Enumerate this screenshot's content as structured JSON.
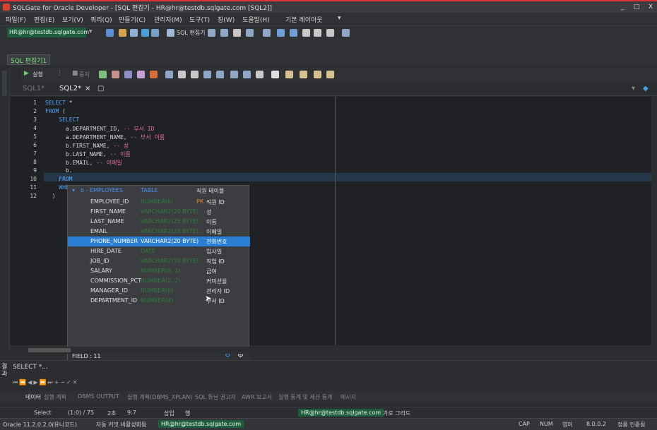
{
  "window": {
    "title": "SQLGate for Oracle Developer - [SQL 편집기 - HR@hr@testdb.sqlgate.com [SQL2]]",
    "controls": [
      "_",
      "□",
      "X"
    ]
  },
  "menu": [
    "파일(F)",
    "편집(E)",
    "보기(V)",
    "쿼리(Q)",
    "만들기(C)",
    "관리자(M)",
    "도구(T)",
    "창(W)",
    "도움말(H)",
    "기본 레이아웃"
  ],
  "toolbar": {
    "connection": "HR@hr@testdb.sqlgate.com",
    "sql_editor_label": "SQL 편집기"
  },
  "doc_tab": "SQL 편집기1",
  "run_toolbar": {
    "run": "실행",
    "stop": "중지"
  },
  "sql_tabs": [
    {
      "label": "SQL1*",
      "active": false
    },
    {
      "label": "SQL2*",
      "active": true
    }
  ],
  "editor": {
    "lines": [
      {
        "n": "1",
        "parts": [
          [
            "kw",
            "SELECT"
          ],
          [
            "",
            " *"
          ]
        ]
      },
      {
        "n": "2",
        "parts": [
          [
            "kw",
            "FROM"
          ],
          [
            "",
            " ("
          ]
        ]
      },
      {
        "n": "3",
        "parts": [
          [
            "kw",
            "    SELECT"
          ]
        ]
      },
      {
        "n": "4",
        "parts": [
          [
            "",
            "      a.DEPARTMENT_ID, "
          ],
          [
            "cmt",
            "-- 부서 ID"
          ]
        ]
      },
      {
        "n": "5",
        "parts": [
          [
            "",
            "      a.DEPARTMENT_NAME, "
          ],
          [
            "cmt",
            "-- 부서 이름"
          ]
        ]
      },
      {
        "n": "6",
        "parts": [
          [
            "",
            "      b.FIRST_NAME, "
          ],
          [
            "cmt",
            "-- 성"
          ]
        ]
      },
      {
        "n": "7",
        "parts": [
          [
            "",
            "      b.LAST_NAME, "
          ],
          [
            "cmt",
            "-- 이름"
          ]
        ]
      },
      {
        "n": "8",
        "parts": [
          [
            "",
            "      b.EMAIL, "
          ],
          [
            "cmt",
            "-- 이메일"
          ]
        ]
      },
      {
        "n": "9",
        "parts": [
          [
            "",
            "      b."
          ]
        ]
      },
      {
        "n": "10",
        "parts": [
          [
            "kw",
            "    FROM"
          ]
        ]
      },
      {
        "n": "11",
        "parts": [
          [
            "kw",
            "    WHER"
          ]
        ]
      },
      {
        "n": "12",
        "parts": [
          [
            "",
            "  )"
          ]
        ]
      }
    ]
  },
  "autocomplete": {
    "header": {
      "alias": "b - EMPLOYEES",
      "kind": "TABLE",
      "desc": "직원 테이블"
    },
    "rows": [
      {
        "col": "EMPLOYEE_ID",
        "type": "NUMBER(6)",
        "pk": "PK",
        "desc": "직원 ID"
      },
      {
        "col": "FIRST_NAME",
        "type": "VARCHAR2(20 BYTE)",
        "pk": "",
        "desc": "성"
      },
      {
        "col": "LAST_NAME",
        "type": "VARCHAR2(25 BYTE)",
        "pk": "",
        "desc": "이름"
      },
      {
        "col": "EMAIL",
        "type": "VARCHAR2(25 BYTE)",
        "pk": "",
        "desc": "이메일"
      },
      {
        "col": "PHONE_NUMBER",
        "type": "VARCHAR2(20 BYTE)",
        "pk": "",
        "desc": "전화번호"
      },
      {
        "col": "HIRE_DATE",
        "type": "DATE",
        "pk": "",
        "desc": "입사일"
      },
      {
        "col": "JOB_ID",
        "type": "VARCHAR2(10 BYTE)",
        "pk": "",
        "desc": "직업 ID"
      },
      {
        "col": "SALARY",
        "type": "NUMBER(8, 2)",
        "pk": "",
        "desc": "급여"
      },
      {
        "col": "COMMISSION_PCT",
        "type": "NUMBER(2, 2)",
        "pk": "",
        "desc": "커미션율"
      },
      {
        "col": "MANAGER_ID",
        "type": "NUMBER(6)",
        "pk": "",
        "desc": "관리자 ID"
      },
      {
        "col": "DEPARTMENT_ID",
        "type": "NUMBER(4)",
        "pk": "",
        "desc": "부서 ID"
      }
    ],
    "selected_index": 4,
    "footer": "FIELD : 11"
  },
  "results": {
    "side_label": "결과",
    "query_preview": "SELECT *..."
  },
  "bottom_tabs": [
    "데이터",
    "실행 계획",
    "DBMS OUTPUT",
    "실행 계획(DBMS_XPLAN)",
    "SQL 튜닝 권고자",
    "AWR 보고서",
    "실행 통계 및 세션 통계",
    "메시지"
  ],
  "status1": {
    "mode": "Select",
    "position": "(1:0) / 75",
    "seconds": "2초",
    "time": "9:7",
    "insert": "삽입",
    "row": "행",
    "connection": "HR@hr@testdb.sqlgate.com",
    "grid": "가로 그리드"
  },
  "status2": {
    "oracle": "Oracle 11.2.0.2.0(유니코드)",
    "autocommit": "자동 커밋 비활성화됨",
    "connection": "HR@hr@testdb.sqlgate.com",
    "cap": "CAP",
    "num": "NUM",
    "lang": "영어",
    "version": "8.0.0.2",
    "license": "정품 인증됨"
  }
}
